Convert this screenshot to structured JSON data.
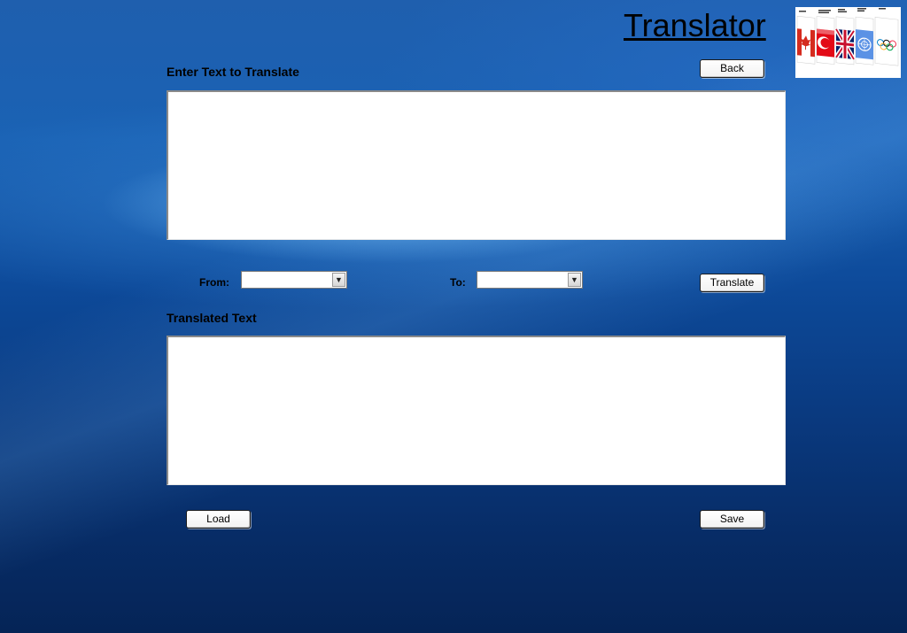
{
  "app": {
    "title": "Translator",
    "flags_image": "flags-banner"
  },
  "input": {
    "label": "Enter Text to Translate",
    "value": ""
  },
  "languages": {
    "from_label": "From:",
    "from_value": "",
    "to_label": "To:",
    "to_value": ""
  },
  "output": {
    "label": "Translated Text",
    "value": ""
  },
  "buttons": {
    "back": "Back",
    "translate": "Translate",
    "load": "Load",
    "save": "Save"
  },
  "colors": {
    "background_top": "#1f5fae",
    "background_bottom": "#052456"
  }
}
